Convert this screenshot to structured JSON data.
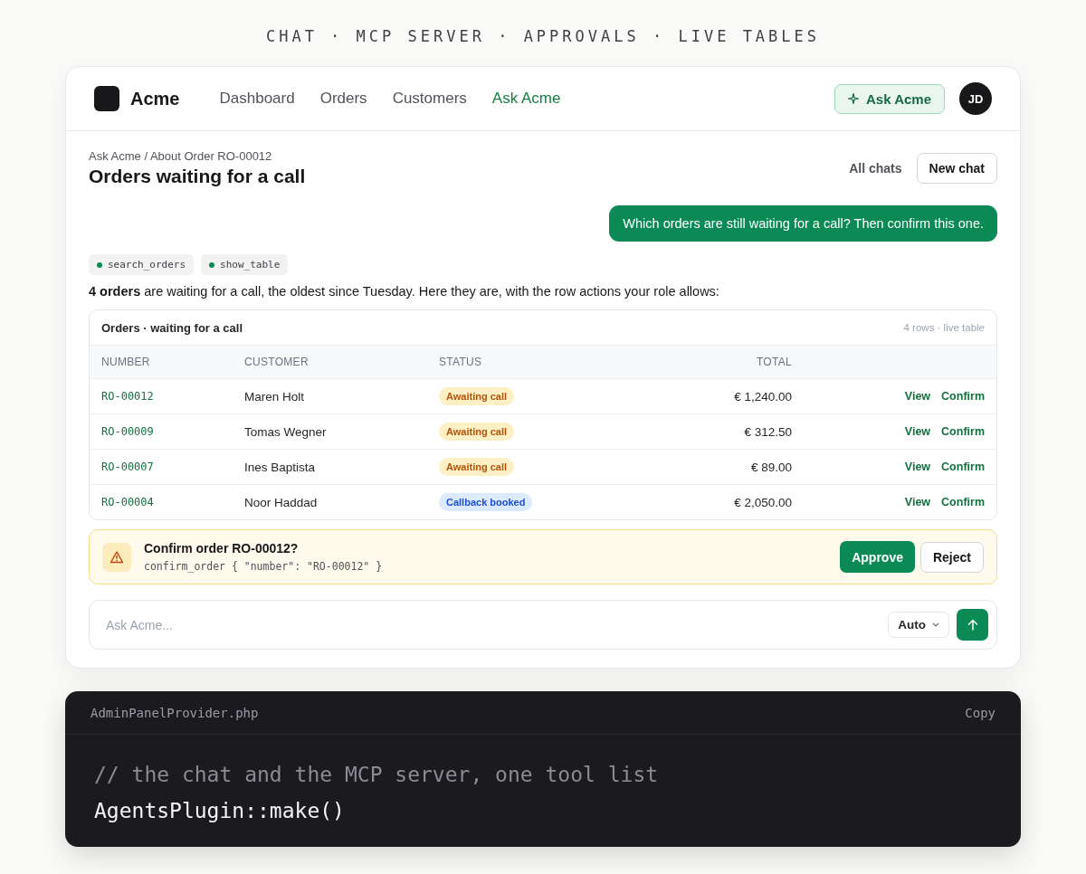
{
  "tagline": "CHAT · MCP SERVER · APPROVALS · LIVE TABLES",
  "brand": "Acme",
  "nav": [
    {
      "label": "Dashboard",
      "selected": false
    },
    {
      "label": "Orders",
      "selected": false
    },
    {
      "label": "Customers",
      "selected": false
    },
    {
      "label": "Ask Acme",
      "selected": true
    }
  ],
  "ask_button": "Ask Acme",
  "avatar": "JD",
  "breadcrumb": "Ask Acme / About Order RO-00012",
  "title": "Orders waiting for a call",
  "all_chats": "All chats",
  "new_chat": "New chat",
  "user_message": "Which orders are still waiting for a call? Then confirm this one.",
  "tools": [
    "search_orders",
    "show_table"
  ],
  "answer": "**4 orders** are waiting for a call, the oldest since Tuesday. Here they are, with the row actions your role allows:",
  "table": {
    "title": "Orders · waiting for a call",
    "meta": "4 rows · live table",
    "columns": [
      "NUMBER",
      "CUSTOMER",
      "STATUS",
      "TOTAL"
    ],
    "rows": [
      {
        "number": "RO-00012",
        "customer": "Maren Holt",
        "status": {
          "label": "Awaiting call",
          "kind": "warning"
        },
        "total": "€ 1,240.00",
        "actions": [
          "View",
          "Confirm"
        ]
      },
      {
        "number": "RO-00009",
        "customer": "Tomas Wegner",
        "status": {
          "label": "Awaiting call",
          "kind": "warning"
        },
        "total": "€ 312.50",
        "actions": [
          "View",
          "Confirm"
        ]
      },
      {
        "number": "RO-00007",
        "customer": "Ines Baptista",
        "status": {
          "label": "Awaiting call",
          "kind": "warning"
        },
        "total": "€ 89.00",
        "actions": [
          "View",
          "Confirm"
        ]
      },
      {
        "number": "RO-00004",
        "customer": "Noor Haddad",
        "status": {
          "label": "Callback booked",
          "kind": "info"
        },
        "total": "€ 2,050.00",
        "actions": [
          "View",
          "Confirm"
        ]
      }
    ]
  },
  "approval": {
    "title": "Confirm order RO-00012?",
    "call": "confirm_order { \"number\": \"RO-00012\" }",
    "approve": "Approve",
    "reject": "Reject"
  },
  "composer": {
    "placeholder": "Ask Acme...",
    "mode": "Auto"
  },
  "code": {
    "filename": "AdminPanelProvider.php",
    "copy": "Copy",
    "lines": [
      {
        "text": "// the chat and the MCP server, one tool list",
        "kind": "comment"
      },
      {
        "text": "AgentsPlugin::make()",
        "kind": "code"
      }
    ]
  }
}
